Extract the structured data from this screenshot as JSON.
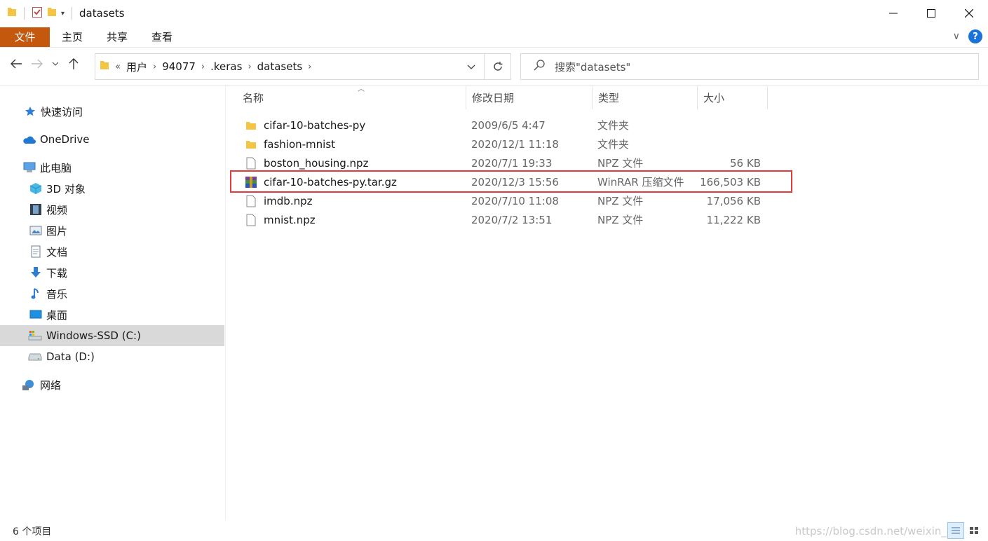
{
  "window": {
    "title": "datasets",
    "controls": {
      "minimize_icon": "minimize-icon",
      "maximize_icon": "maximize-icon",
      "close_icon": "close-icon"
    }
  },
  "ribbon": {
    "tabs": [
      {
        "label": "文件",
        "active": true
      },
      {
        "label": "主页"
      },
      {
        "label": "共享"
      },
      {
        "label": "查看"
      }
    ],
    "accent": "#c4590e",
    "help_label": "?"
  },
  "address": {
    "overflow": "«",
    "crumbs": [
      "用户",
      "94077",
      ".keras",
      "datasets"
    ]
  },
  "search": {
    "placeholder": "搜索\"datasets\""
  },
  "sidebar": {
    "items": [
      {
        "label": "快速访问",
        "icon": "star-icon"
      },
      {
        "label": "OneDrive",
        "icon": "cloud-icon"
      },
      {
        "label": "此电脑",
        "icon": "computer-icon"
      },
      {
        "label": "3D 对象",
        "icon": "cube-icon"
      },
      {
        "label": "视频",
        "icon": "film-icon"
      },
      {
        "label": "图片",
        "icon": "picture-icon"
      },
      {
        "label": "文档",
        "icon": "document-icon"
      },
      {
        "label": "下载",
        "icon": "download-icon"
      },
      {
        "label": "音乐",
        "icon": "music-icon"
      },
      {
        "label": "桌面",
        "icon": "desktop-icon"
      },
      {
        "label": "Windows-SSD (C:)",
        "icon": "drive-c-icon",
        "selected": true
      },
      {
        "label": "Data (D:)",
        "icon": "drive-d-icon"
      },
      {
        "label": "网络",
        "icon": "network-icon"
      }
    ]
  },
  "file_list": {
    "columns": [
      "名称",
      "修改日期",
      "类型",
      "大小"
    ],
    "rows": [
      {
        "name": "cifar-10-batches-py",
        "date": "2009/6/5 4:47",
        "type": "文件夹",
        "size": "",
        "icon": "folder-icon"
      },
      {
        "name": "fashion-mnist",
        "date": "2020/12/1 11:18",
        "type": "文件夹",
        "size": "",
        "icon": "folder-icon"
      },
      {
        "name": "boston_housing.npz",
        "date": "2020/7/1 19:33",
        "type": "NPZ 文件",
        "size": "56 KB",
        "icon": "file-icon"
      },
      {
        "name": "cifar-10-batches-py.tar.gz",
        "date": "2020/12/3 15:56",
        "type": "WinRAR 压缩文件",
        "size": "166,503 KB",
        "icon": "winrar-icon",
        "highlighted": true
      },
      {
        "name": "imdb.npz",
        "date": "2020/7/10 11:08",
        "type": "NPZ 文件",
        "size": "17,056 KB",
        "icon": "file-icon"
      },
      {
        "name": "mnist.npz",
        "date": "2020/7/2 13:51",
        "type": "NPZ 文件",
        "size": "11,222 KB",
        "icon": "file-icon"
      }
    ],
    "highlight_color": "#e03c3c"
  },
  "status": {
    "item_count": "6 个项目",
    "watermark": "https://blog.csdn.net/weixin_42"
  }
}
